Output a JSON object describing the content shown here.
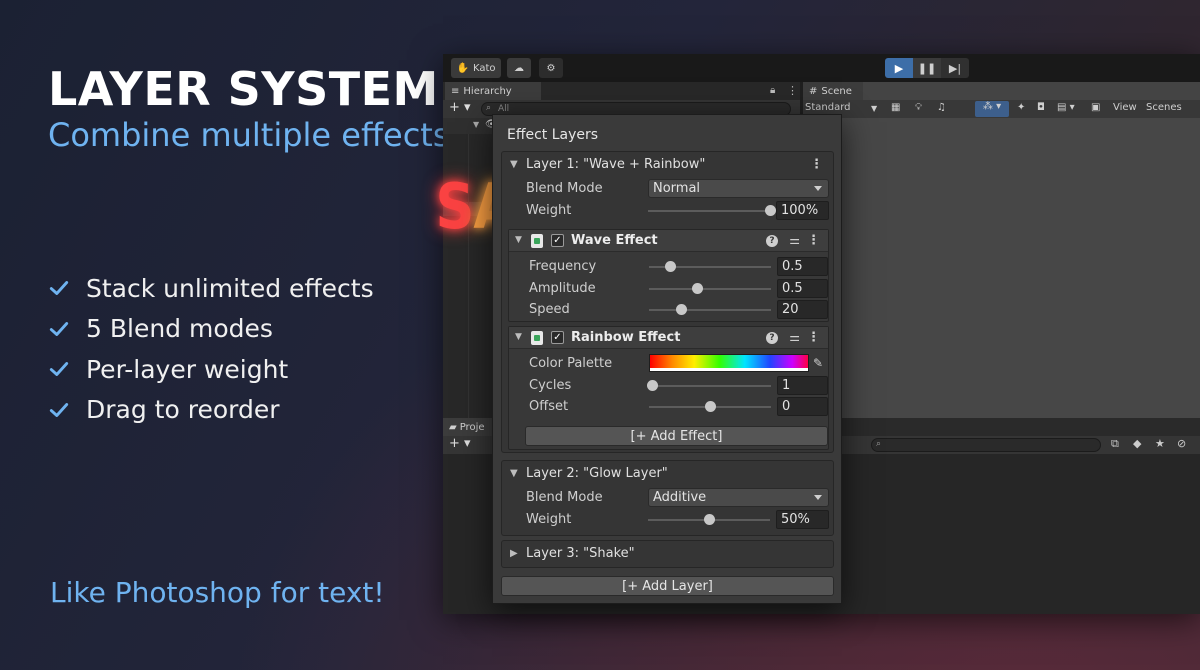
{
  "hero": {
    "title": "LAYER SYSTEM",
    "subtitle": "Combine multiple effects",
    "features": [
      "Stack unlimited effects",
      "5 Blend modes",
      "Per-layer weight",
      "Drag to reorder"
    ],
    "tagline": "Like Photoshop for text!"
  },
  "editor": {
    "toolbar": {
      "account_label": "Kato"
    },
    "hierarchy": {
      "tab_label": "Hierarchy",
      "search_placeholder": "All"
    },
    "scene": {
      "tab_label": "Scene",
      "shading_mode": "Standard",
      "view_label": "View",
      "scenes_label": "Scenes",
      "sample_text": "SAMPLE TEXT"
    },
    "project": {
      "tab_label": "Proje"
    }
  },
  "popup": {
    "title": "Effect Layers",
    "add_layer_label": "[+ Add Layer]",
    "layers": [
      {
        "name": "Layer 1: \"Wave + Rainbow\"",
        "blend_label": "Blend Mode",
        "blend_value": "Normal",
        "weight_label": "Weight",
        "weight_value": "100%",
        "weight_fraction": 1.0,
        "add_effect_label": "[+ Add Effect]",
        "effects": [
          {
            "name": "Wave Effect",
            "enabled": true,
            "params": [
              {
                "label": "Frequency",
                "value": "0.5",
                "fraction": 0.18
              },
              {
                "label": "Amplitude",
                "value": "0.5",
                "fraction": 0.4
              },
              {
                "label": "Speed",
                "value": "20",
                "fraction": 0.27
              }
            ]
          },
          {
            "name": "Rainbow Effect",
            "enabled": true,
            "palette_label": "Color Palette",
            "params": [
              {
                "label": "Cycles",
                "value": "1",
                "fraction": 0.03
              },
              {
                "label": "Offset",
                "value": "0",
                "fraction": 0.5
              }
            ]
          }
        ]
      },
      {
        "name": "Layer 2: \"Glow Layer\"",
        "blend_label": "Blend Mode",
        "blend_value": "Additive",
        "weight_label": "Weight",
        "weight_value": "50%",
        "weight_fraction": 0.5
      },
      {
        "name": "Layer 3: \"Shake\""
      }
    ]
  },
  "colors": {
    "accent_blue": "#6fb3f0",
    "play_button": "#3d6ea8"
  }
}
